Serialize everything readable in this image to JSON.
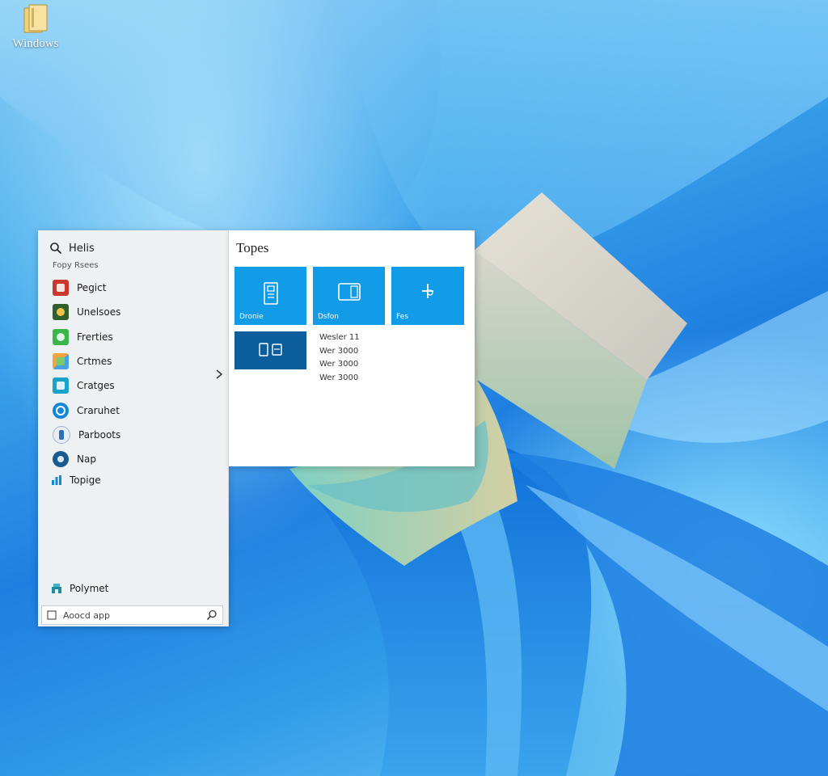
{
  "desktop": {
    "icon_label": "Windows"
  },
  "start_menu": {
    "search_label": "Helis",
    "section_label": "Fopy Rsees",
    "apps": [
      {
        "label": "Pegict",
        "icon": "red-app-icon",
        "color": "#c9382a"
      },
      {
        "label": "Unelsoes",
        "icon": "dark-green-app-icon",
        "color": "#2f5e2b"
      },
      {
        "label": "Frerties",
        "icon": "green-app-icon",
        "color": "#39b54a"
      },
      {
        "label": "Crtmes",
        "icon": "colorful-app-icon",
        "color": "#f2a43a"
      },
      {
        "label": "Cratges",
        "icon": "teal-app-icon",
        "color": "#1aa3c9"
      },
      {
        "label": "Craruhet",
        "icon": "blue-app-icon",
        "color": "#1287d6"
      },
      {
        "label": "Parboots",
        "icon": "globe-app-icon",
        "color": "#2c6fb5"
      },
      {
        "label": "Nap",
        "icon": "map-app-icon",
        "color": "#1b5a8f"
      }
    ],
    "topge_label": "Topige",
    "poly_label": "Polymet",
    "bottom_search_placeholder": "Aoocd app"
  },
  "tiles_panel": {
    "title": "Topes",
    "tiles": [
      {
        "label": "Dronie",
        "icon": "document-icon"
      },
      {
        "label": "Dsfon",
        "icon": "tablet-icon"
      },
      {
        "label": "Fes",
        "icon": "plus-icon"
      },
      {
        "label": "",
        "icon": "devices-icon"
      }
    ],
    "info_lines": [
      "Wesler 11",
      "Wer 3000",
      "Wer 3000",
      "Wer 3000"
    ]
  },
  "colors": {
    "tile_blue": "#129be7",
    "tile_dark": "#0b5e9b"
  }
}
